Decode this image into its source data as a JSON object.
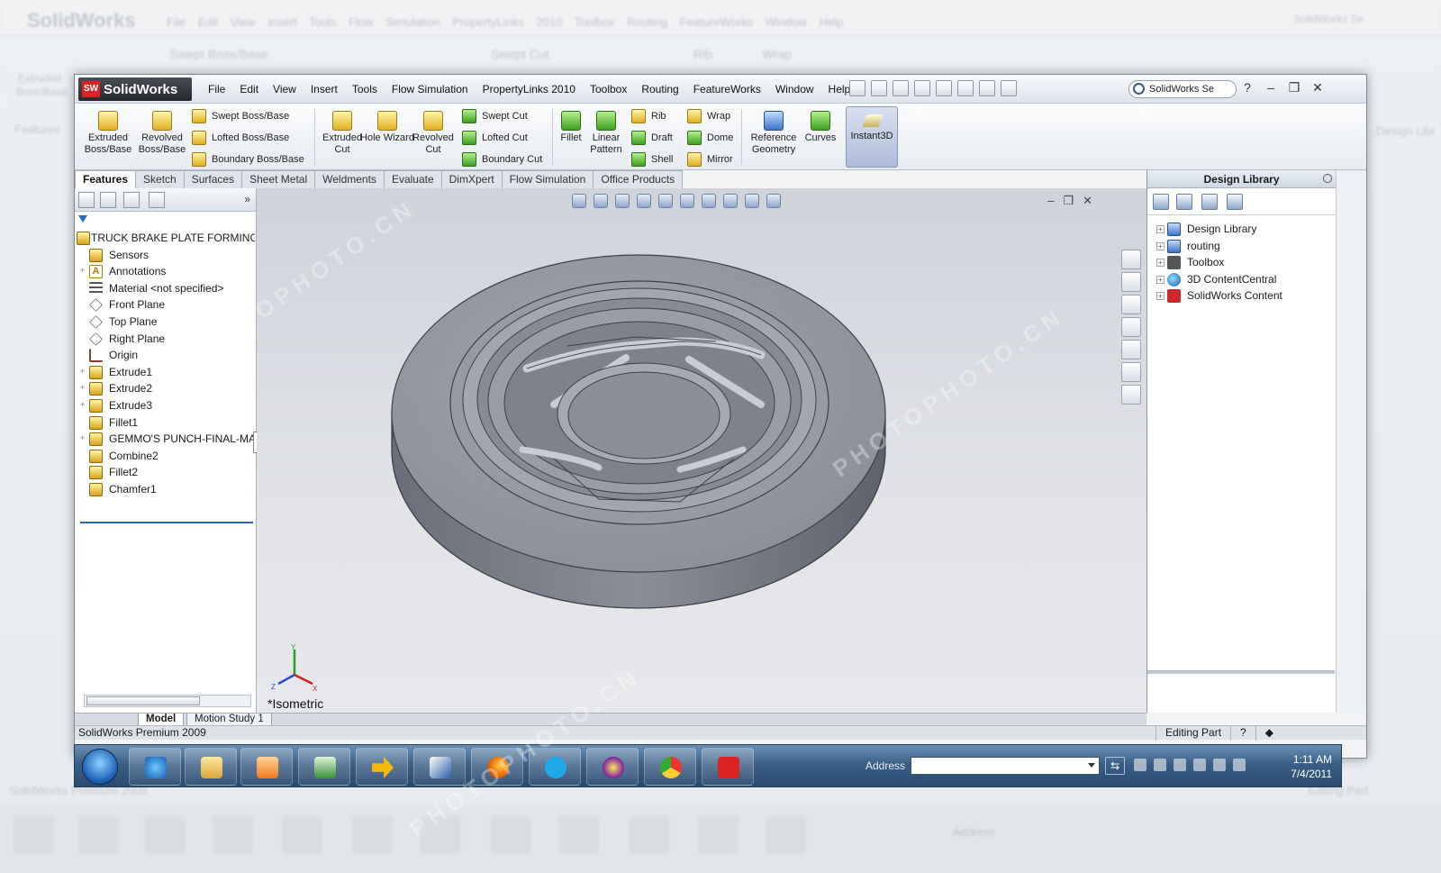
{
  "background": {
    "title": "SolidWorks",
    "menu": [
      "File",
      "Edit",
      "View",
      "Insert",
      "Tools",
      "Flow Simulation",
      "PropertyLinks 2010",
      "Toolbox",
      "Routing",
      "FeatureWorks",
      "Window",
      "Help"
    ],
    "search": "SolidWorks Se",
    "ribbon_texts": [
      "Swept Boss/Base",
      "Swept Cut",
      "Rib",
      "Wrap"
    ],
    "left_labels": [
      "Extruded",
      "Boss/Base",
      "Features"
    ],
    "right_label": "Design Libr",
    "bottom_status": "SolidWorks Premium 2009",
    "bottom_right": "Editing Part",
    "address_label": "Address"
  },
  "app": {
    "logo_text": "SolidWorks",
    "logo_badge": "SW",
    "menu": [
      "File",
      "Edit",
      "View",
      "Insert",
      "Tools",
      "Flow Simulation",
      "PropertyLinks 2010",
      "Toolbox",
      "Routing",
      "FeatureWorks",
      "Window",
      "Help"
    ],
    "search_placeholder": "SolidWorks Se",
    "window_controls": [
      "?",
      "–",
      "❐",
      "✕"
    ]
  },
  "ribbon": {
    "extruded_boss": "Extruded Boss/Base",
    "revolved_boss": "Revolved Boss/Base",
    "swept_boss": "Swept Boss/Base",
    "lofted_boss": "Lofted Boss/Base",
    "boundary_boss": "Boundary Boss/Base",
    "extruded_cut": "Extruded Cut",
    "hole_wizard": "Hole Wizard",
    "revolved_cut": "Revolved Cut",
    "swept_cut": "Swept Cut",
    "lofted_cut": "Lofted Cut",
    "boundary_cut": "Boundary Cut",
    "fillet": "Fillet",
    "linear_pattern": "Linear Pattern",
    "rib": "Rib",
    "draft": "Draft",
    "shell": "Shell",
    "wrap": "Wrap",
    "dome": "Dome",
    "mirror": "Mirror",
    "reference_geometry": "Reference Geometry",
    "curves": "Curves",
    "instant3d": "Instant3D"
  },
  "tabs": [
    "Features",
    "Sketch",
    "Surfaces",
    "Sheet Metal",
    "Weldments",
    "Evaluate",
    "DimXpert",
    "Flow Simulation",
    "Office Products"
  ],
  "feature_tree": {
    "root": "TRUCK BRAKE PLATE FORMING D",
    "items": [
      {
        "label": "Sensors",
        "icon": "sensor-icon",
        "expand": ""
      },
      {
        "label": "Annotations",
        "icon": "annotation-icon",
        "expand": "+"
      },
      {
        "label": "Material <not specified>",
        "icon": "material-icon",
        "expand": ""
      },
      {
        "label": "Front Plane",
        "icon": "plane-icon",
        "expand": ""
      },
      {
        "label": "Top Plane",
        "icon": "plane-icon",
        "expand": ""
      },
      {
        "label": "Right Plane",
        "icon": "plane-icon",
        "expand": ""
      },
      {
        "label": "Origin",
        "icon": "origin-icon",
        "expand": ""
      },
      {
        "label": "Extrude1",
        "icon": "extrude-icon",
        "expand": "+"
      },
      {
        "label": "Extrude2",
        "icon": "extrude-icon",
        "expand": "+"
      },
      {
        "label": "Extrude3",
        "icon": "extrude-icon",
        "expand": "+"
      },
      {
        "label": "Fillet1",
        "icon": "fillet-icon",
        "expand": ""
      },
      {
        "label": "GEMMO'S PUNCH-FINAL-MA",
        "icon": "part-icon",
        "expand": "+"
      },
      {
        "label": "Combine2",
        "icon": "combine-icon",
        "expand": ""
      },
      {
        "label": "Fillet2",
        "icon": "fillet-icon",
        "expand": ""
      },
      {
        "label": "Chamfer1",
        "icon": "chamfer-icon",
        "expand": ""
      }
    ],
    "panel_chevron": "»"
  },
  "viewport": {
    "view_label": "*Isometric",
    "triad": {
      "x": "X",
      "y": "Y",
      "z": "Z"
    }
  },
  "model_tabs": [
    "Model",
    "Motion Study 1"
  ],
  "status": {
    "product": "SolidWorks Premium 2009",
    "mode": "Editing Part",
    "help": "?"
  },
  "design_library": {
    "title": "Design Library",
    "items": [
      {
        "label": "Design Library",
        "icon": "library-icon"
      },
      {
        "label": "routing",
        "icon": "routing-icon"
      },
      {
        "label": "Toolbox",
        "icon": "toolbox-icon"
      },
      {
        "label": "3D ContentCentral",
        "icon": "globe-icon"
      },
      {
        "label": "SolidWorks Content",
        "icon": "solidworks-content-icon"
      }
    ]
  },
  "taskbar": {
    "address_label": "Address",
    "time": "1:11 AM",
    "date": "7/4/2011",
    "apps": [
      "internet-explorer-icon",
      "folder-icon",
      "media-player-icon",
      "calculator-icon",
      "arrow-icon",
      "feather-icon",
      "firefox-icon",
      "skype-icon",
      "yahoo-messenger-icon",
      "chrome-icon",
      "solidworks-icon"
    ]
  },
  "watermark": "PHOTOPHOTO.CN",
  "colors": {
    "accent_blue": "#2a66c2",
    "solidworks_red": "#d22222",
    "part_gray": "#8f929c",
    "taskbar": "#3c5f86"
  }
}
